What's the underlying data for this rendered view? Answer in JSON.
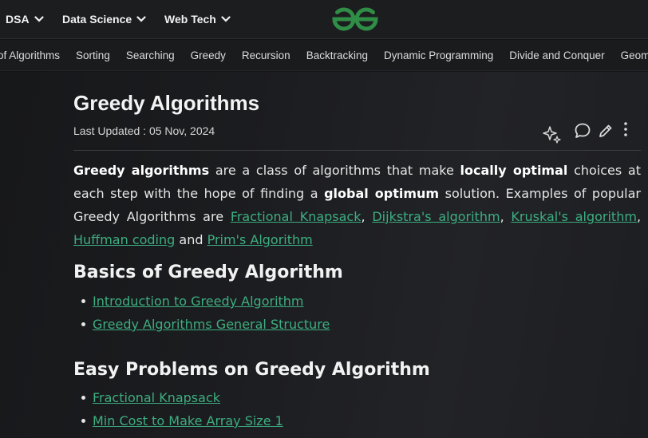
{
  "topnav": {
    "items": [
      {
        "label": "DSA"
      },
      {
        "label": "Data Science"
      },
      {
        "label": "Web Tech"
      }
    ]
  },
  "subnav": {
    "items": [
      "of Algorithms",
      "Sorting",
      "Searching",
      "Greedy",
      "Recursion",
      "Backtracking",
      "Dynamic Programming",
      "Divide and Conquer",
      "Geometric"
    ]
  },
  "article": {
    "title": "Greedy Algorithms",
    "updated": "Last Updated : 05 Nov, 2024",
    "intro": {
      "t1": "Greedy algorithms",
      "t2": " are a class of algorithms that make ",
      "t3": "locally optimal",
      "t4": " choices at each step with the hope of finding a ",
      "t5": "global optimum",
      "t6": " solution. Examples of popular Greedy Algorithms are ",
      "link1": "Fractional Knapsack",
      "sep1": ", ",
      "link2": "Dijkstra's algorithm",
      "sep2": ", ",
      "link3": "Kruskal's algorithm",
      "sep3": ", ",
      "link4": "Huffman coding",
      "t7": " and ",
      "link5": "Prim's Algorithm"
    },
    "sections": [
      {
        "heading": "Basics of Greedy Algorithm",
        "links": [
          "Introduction to Greedy Algorithm",
          "Greedy Algorithms General Structure"
        ]
      },
      {
        "heading": "Easy Problems on Greedy Algorithm",
        "links": [
          "Fractional Knapsack",
          "Min Cost to Make Array Size 1"
        ]
      }
    ]
  },
  "colors": {
    "brand": "#2f8d46",
    "link": "#3dae80",
    "background": "#131416"
  },
  "icons": [
    "chevron-down-icon",
    "gfg-logo",
    "ai-sparkle-icon",
    "comment-icon",
    "edit-pencil-icon",
    "more-vertical-icon"
  ]
}
